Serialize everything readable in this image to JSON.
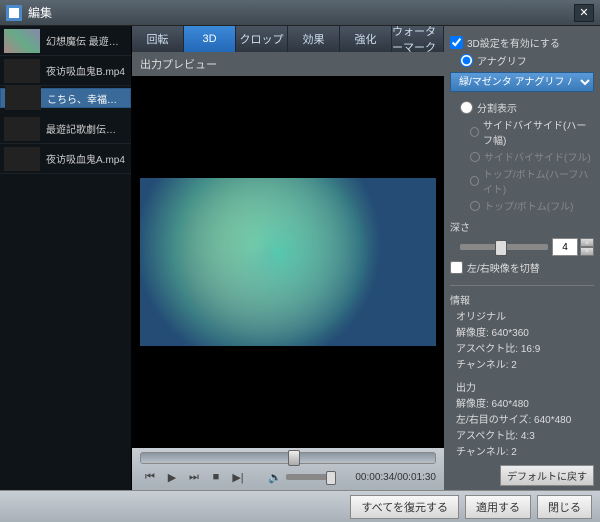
{
  "window": {
    "title": "編集"
  },
  "sidebar": {
    "items": [
      {
        "name": "幻想魔伝 最遊…"
      },
      {
        "name": "夜访吸血鬼B.mp4"
      },
      {
        "name": "こちら、幸福安…"
      },
      {
        "name": "最遊記歌劇伝…"
      },
      {
        "name": "夜访吸血鬼A.mp4"
      }
    ]
  },
  "tabs": [
    "回転",
    "3D",
    "クロップ",
    "効果",
    "強化",
    "ウォーターマーク"
  ],
  "activeTab": 1,
  "previewLabel": "出力プレビュー",
  "playback": {
    "time": "00:00:34/00:01:30"
  },
  "settings": {
    "enable3d": "3D設定を有効にする",
    "anaglyph": "アナグリフ",
    "anaglyphOption": "緑/マゼンタ アナグリフ ハーフカラー",
    "split": "分割表示",
    "splitOptions": [
      "サイドバイサイド(ハーフ幅)",
      "サイドバイサイド(フル)",
      "トップ/ボトム(ハーフハイト)",
      "トップ/ボトム(フル)"
    ],
    "depth": "深さ",
    "depthValue": "4",
    "swap": "左/右映像を切替"
  },
  "info": {
    "header": "情報",
    "original": {
      "label": "オリジナル",
      "resolution": "解像度: 640*360",
      "aspect": "アスペクト比: 16:9",
      "channel": "チャンネル: 2"
    },
    "output": {
      "label": "出力",
      "resolution": "解像度: 640*480",
      "eyesize": "左/右目のサイズ: 640*480",
      "aspect": "アスペクト比: 4:3",
      "channel": "チャンネル: 2"
    },
    "defaultBtn": "デフォルトに戻す"
  },
  "footer": {
    "restoreAll": "すべてを復元する",
    "apply": "適用する",
    "close": "閉じる"
  }
}
